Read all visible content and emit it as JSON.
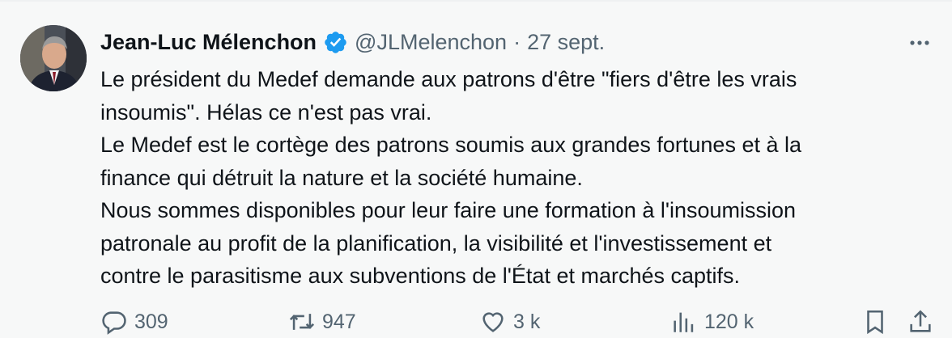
{
  "tweet": {
    "author_name": "Jean-Luc Mélenchon",
    "handle": "@JLMelenchon",
    "separator": "·",
    "date": "27 sept.",
    "text_lines": [
      "Le président du Medef demande aux patrons d'être \"fiers d'être les vrais",
      "insoumis\". Hélas ce n'est pas vrai.",
      "Le Medef est le cortège des patrons soumis aux grandes fortunes et à la",
      "finance qui détruit la nature et la société humaine.",
      "Nous sommes disponibles pour leur faire une formation à l'insoumission",
      "patronale au profit de la planification, la visibilité et l'investissement et",
      "contre le parasitisme aux subventions de l'État et marchés captifs."
    ]
  },
  "actions": {
    "replies": "309",
    "reposts": "947",
    "likes": "3 k",
    "views": "120 k"
  },
  "icons": {
    "verified": "verified-badge-icon",
    "more": "more-options-icon",
    "reply": "reply-icon",
    "repost": "repost-icon",
    "like": "like-icon",
    "views": "views-icon",
    "bookmark": "bookmark-icon",
    "share": "share-icon"
  },
  "colors": {
    "verified": "#1d9bf0",
    "text": "#0f1419",
    "secondary": "#536471",
    "background": "#f7f8f8"
  }
}
